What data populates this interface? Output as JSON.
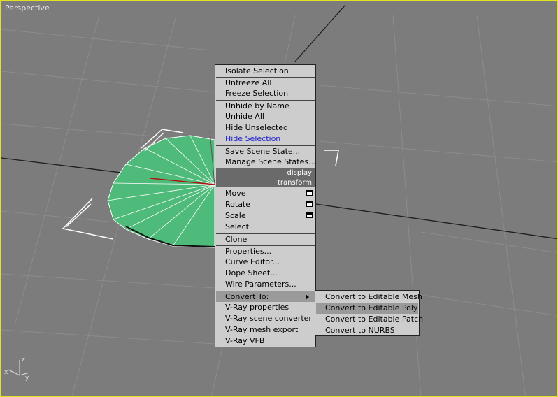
{
  "viewport": {
    "label": "Perspective",
    "border_color": "#e2e222",
    "object_color": "#4fbb7a"
  },
  "axis": {
    "x": "x",
    "y": "y",
    "z": "z"
  },
  "quad_menu": {
    "groups": {
      "display": {
        "header": "display",
        "items": [
          "Isolate Selection",
          "Unfreeze All",
          "Freeze Selection",
          "Unhide by Name",
          "Unhide All",
          "Hide Unselected",
          "Hide Selection",
          "Save Scene State...",
          "Manage Scene States..."
        ]
      },
      "transform": {
        "header": "transform",
        "items": [
          "Move",
          "Rotate",
          "Scale",
          "Select",
          "Clone",
          "Properties...",
          "Curve Editor...",
          "Dope Sheet...",
          "Wire Parameters...",
          "Convert To:",
          "V-Ray properties",
          "V-Ray scene converter",
          "V-Ray mesh export",
          "V-Ray VFB"
        ]
      }
    }
  },
  "convert_submenu": {
    "items": [
      "Convert to Editable Mesh",
      "Convert to Editable Poly",
      "Convert to Editable Patch",
      "Convert to NURBS"
    ]
  }
}
